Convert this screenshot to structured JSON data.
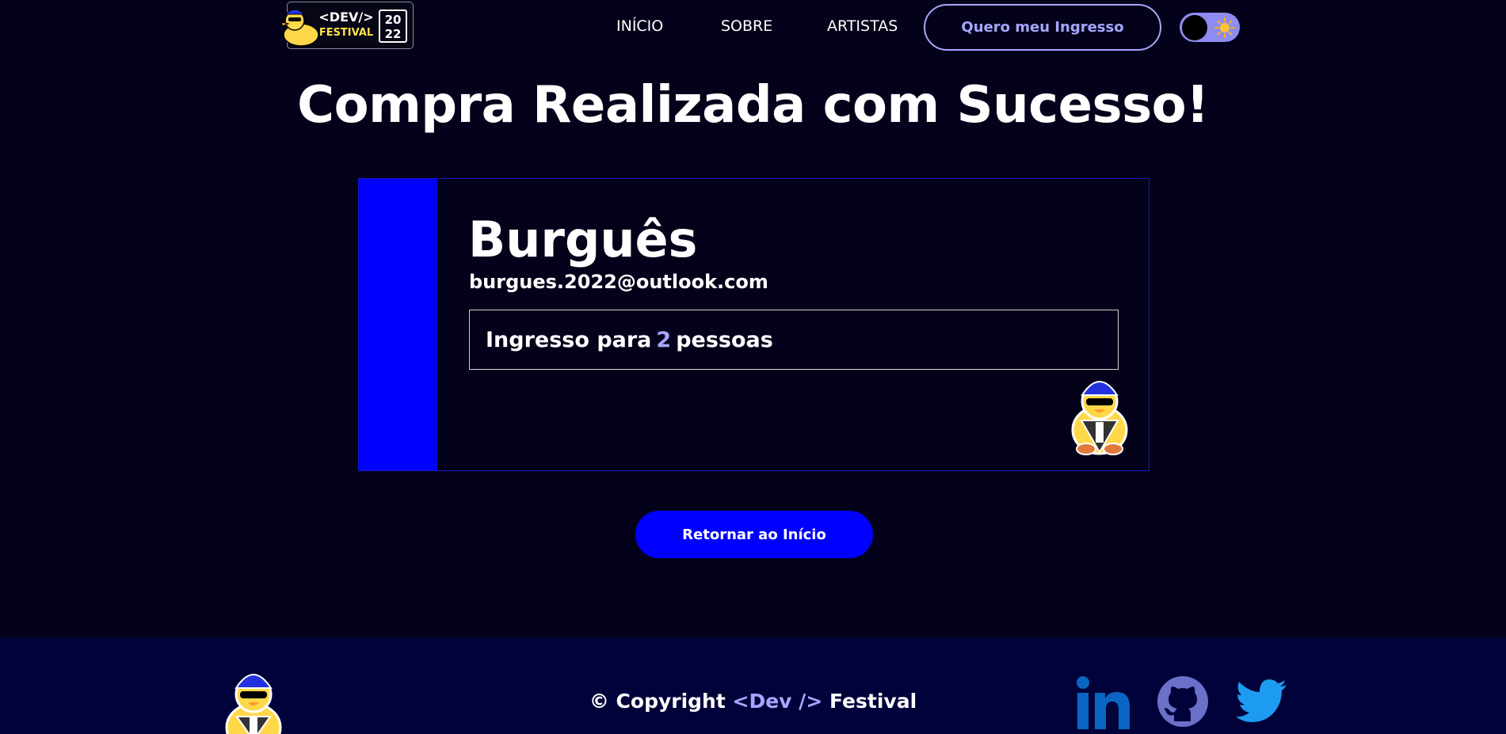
{
  "header": {
    "logo": {
      "line1": "<DEV/>",
      "line2": "FESTIVAL",
      "year_top": "20",
      "year_bottom": "22"
    },
    "nav": [
      {
        "label": "INÍCIO"
      },
      {
        "label": "SOBRE"
      },
      {
        "label": "ARTISTAS"
      }
    ],
    "cta_label": "Quero meu Ingresso",
    "theme_toggle": {
      "state": "dark",
      "icon": "sun-icon"
    }
  },
  "main": {
    "title": "Compra Realizada com Sucesso!",
    "ticket": {
      "name": "Burguês",
      "email": "burgues.2022@outlook.com",
      "quantity_prefix": "Ingresso para",
      "quantity": "2",
      "quantity_suffix": "pessoas"
    },
    "return_label": "Retornar ao Início"
  },
  "footer": {
    "copyright_prefix": "© Copyright",
    "copyright_brand": "<Dev />",
    "copyright_suffix": "Festival",
    "social": [
      "linkedin-icon",
      "github-icon",
      "twitter-icon"
    ]
  },
  "colors": {
    "background": "#03021a",
    "accent": "#a7a6ff",
    "primary_blue": "#0000ff",
    "footer_bg": "#02023a",
    "social_blue": "#0a66c2",
    "twitter_blue": "#1d9bf0"
  }
}
